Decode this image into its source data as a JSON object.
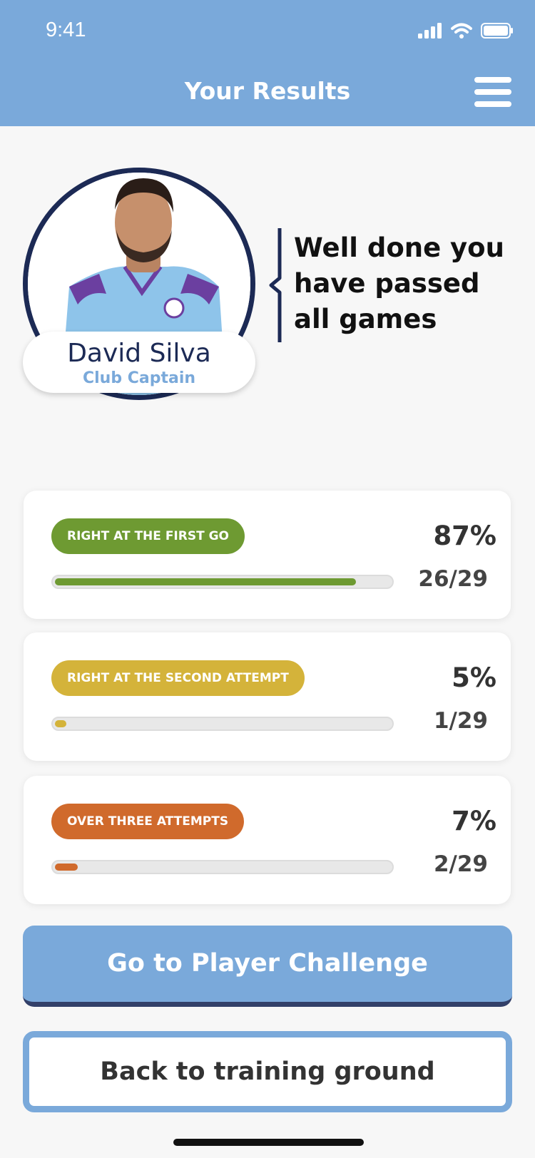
{
  "status_bar": {
    "time": "9:41",
    "icons": [
      "signal-icon",
      "wifi-icon",
      "battery-icon"
    ]
  },
  "header": {
    "title": "Your Results",
    "menu_icon": "hamburger-menu-icon"
  },
  "player": {
    "name": "David Silva",
    "role": "Club Captain"
  },
  "message": "Well done you have passed all games",
  "results": [
    {
      "label": "RIGHT AT THE FIRST GO",
      "percent": "87%",
      "fraction": "26/29",
      "progress": 0.897,
      "color": "#6e9a32"
    },
    {
      "label": "RIGHT AT THE SECOND ATTEMPT",
      "percent": "5%",
      "fraction": "1/29",
      "progress": 0.0345,
      "color": "#d4b33a"
    },
    {
      "label": "OVER THREE ATTEMPTS",
      "percent": "7%",
      "fraction": "2/29",
      "progress": 0.069,
      "color": "#d06a2c"
    }
  ],
  "buttons": {
    "primary": "Go to Player Challenge",
    "secondary": "Back to training ground"
  },
  "colors": {
    "header_bg": "#7aa9da",
    "navy": "#1c2a55",
    "accent_blue": "#7aa9da"
  }
}
